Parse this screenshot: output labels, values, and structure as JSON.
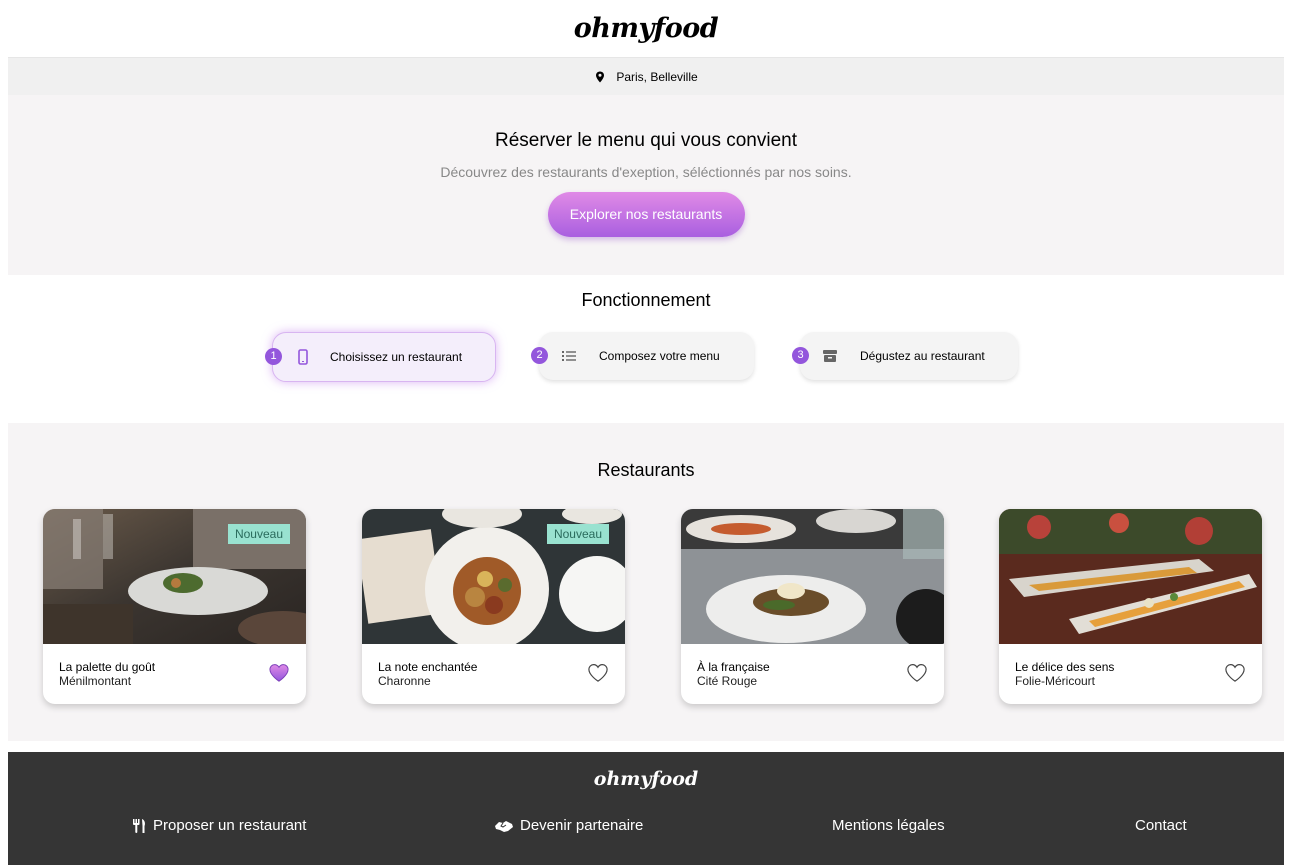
{
  "header": {
    "logo": "ohmyfood"
  },
  "location": {
    "icon": "map-pin-icon",
    "text": "Paris, Belleville"
  },
  "hero": {
    "title": "Réserver le menu qui vous convient",
    "subtitle": "Découvrez des restaurants d'exeption, séléctionnés par nos soins.",
    "cta_label": "Explorer nos restaurants"
  },
  "how": {
    "title": "Fonctionnement",
    "steps": [
      {
        "number": "1",
        "label": "Choisissez un restaurant",
        "icon": "mobile-phone-icon"
      },
      {
        "number": "2",
        "label": "Composez votre menu",
        "icon": "list-icon"
      },
      {
        "number": "3",
        "label": "Dégustez au restaurant",
        "icon": "store-icon"
      }
    ]
  },
  "restaurants": {
    "title": "Restaurants",
    "items": [
      {
        "name": "La palette du goût",
        "area": "Ménilmontant",
        "badge": "Nouveau",
        "favorite": true
      },
      {
        "name": "La note enchantée",
        "area": "Charonne",
        "badge": "Nouveau",
        "favorite": false
      },
      {
        "name": "À la française",
        "area": "Cité Rouge",
        "badge": "",
        "favorite": false
      },
      {
        "name": "Le délice des sens",
        "area": "Folie-Méricourt",
        "badge": "",
        "favorite": false
      }
    ]
  },
  "footer": {
    "logo": "ohmyfood",
    "links": [
      {
        "label": "Proposer un restaurant",
        "icon": "utensils-icon"
      },
      {
        "label": "Devenir partenaire",
        "icon": "handshake-icon"
      },
      {
        "label": "Mentions légales",
        "icon": ""
      },
      {
        "label": "Contact",
        "icon": ""
      }
    ]
  },
  "colors": {
    "accent": "#9356dc",
    "cta_top": "#e08ae6",
    "cta_bottom": "#a95fe0",
    "badge": "#99e2d0",
    "footer_bg": "#353535"
  }
}
